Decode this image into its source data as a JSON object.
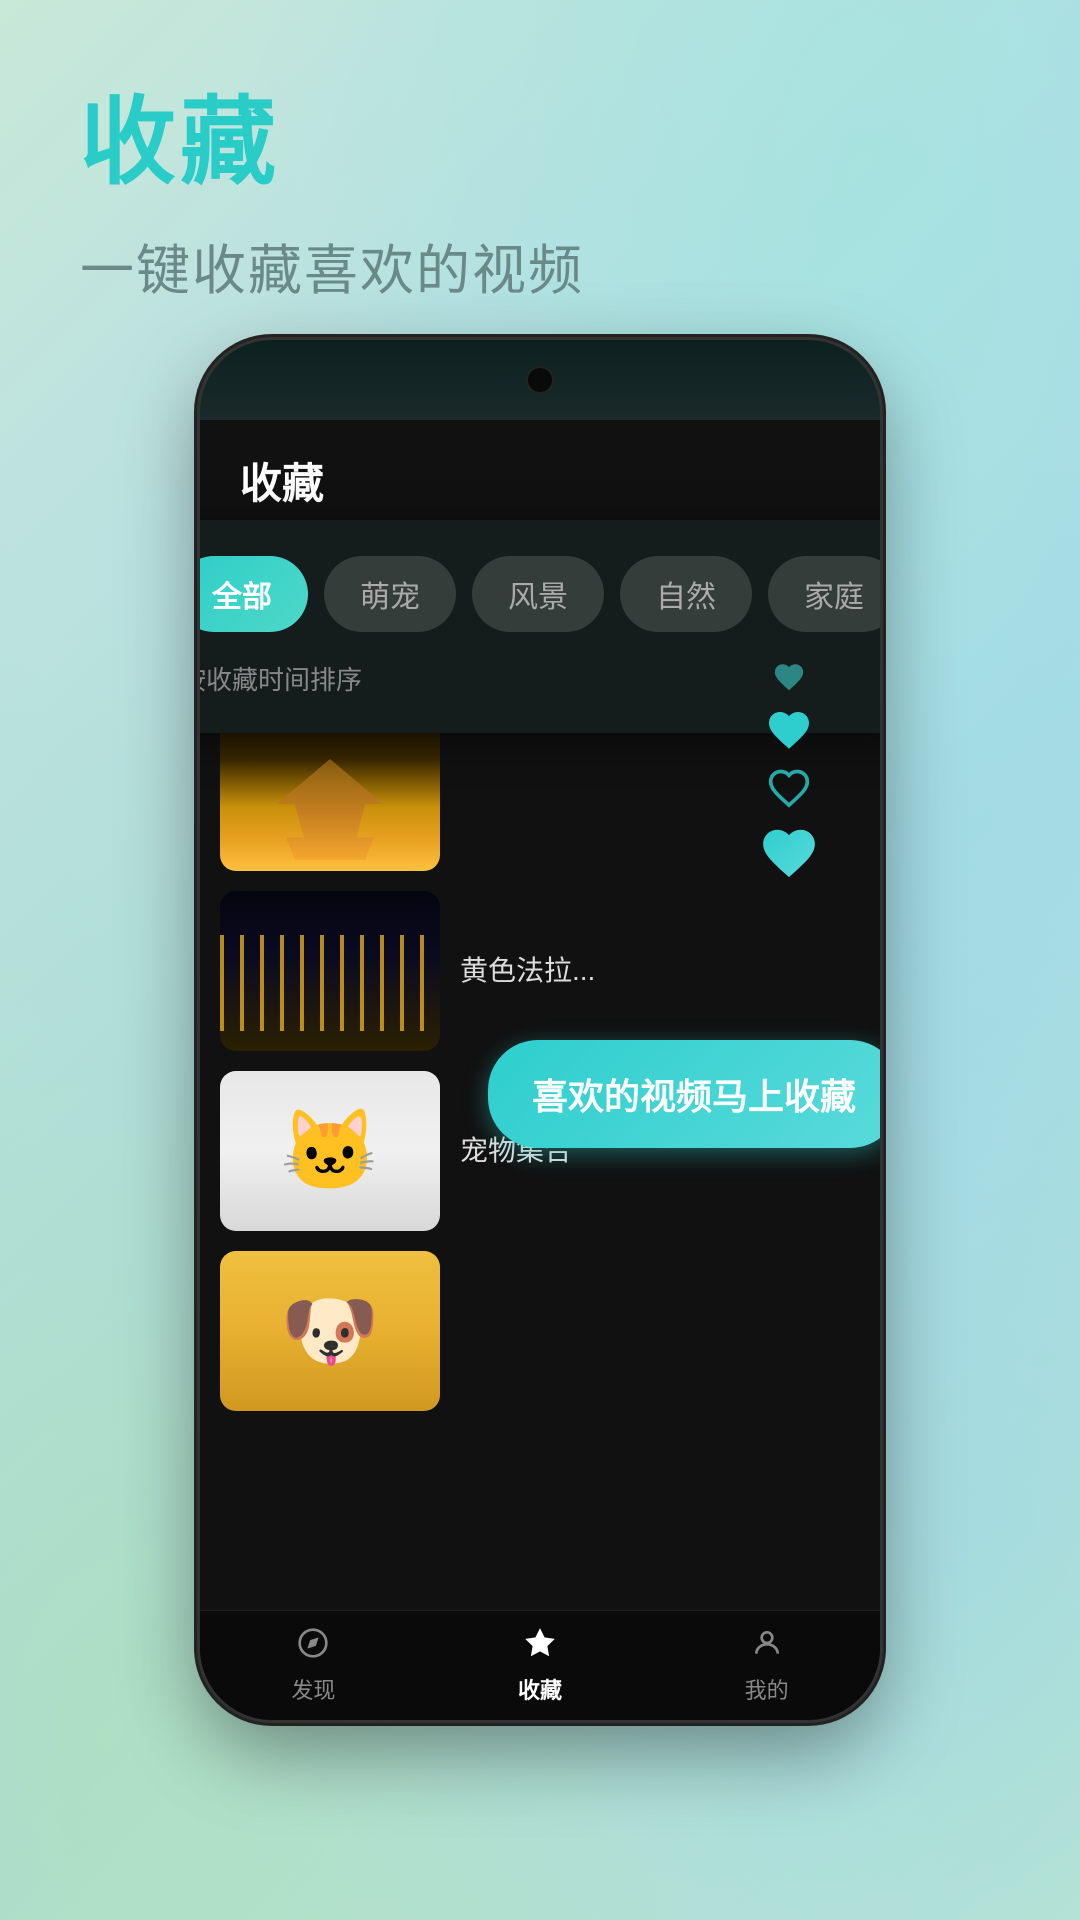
{
  "page": {
    "background": "gradient-light-mint-cyan",
    "main_title": "收藏",
    "subtitle": "一键收藏喜欢的视频"
  },
  "phone": {
    "app_title": "收藏",
    "filter_tabs": [
      {
        "label": "全部",
        "active": true
      },
      {
        "label": "萌宠",
        "active": false
      },
      {
        "label": "风景",
        "active": false
      },
      {
        "label": "自然",
        "active": false
      },
      {
        "label": "家庭",
        "active": false
      }
    ],
    "sort_label": "按收藏时间排序",
    "videos": [
      {
        "title": "",
        "thumb_type": "eiffel"
      },
      {
        "title": "黄色法拉...",
        "thumb_type": "city"
      },
      {
        "title": "宠物集合",
        "thumb_type": "cat"
      },
      {
        "title": "",
        "thumb_type": "dog"
      }
    ],
    "tooltip": "喜欢的视频马上收藏",
    "bottom_nav": [
      {
        "label": "发现",
        "active": false,
        "icon": "compass"
      },
      {
        "label": "收藏",
        "active": true,
        "icon": "star"
      },
      {
        "label": "我的",
        "active": false,
        "icon": "person"
      }
    ]
  }
}
